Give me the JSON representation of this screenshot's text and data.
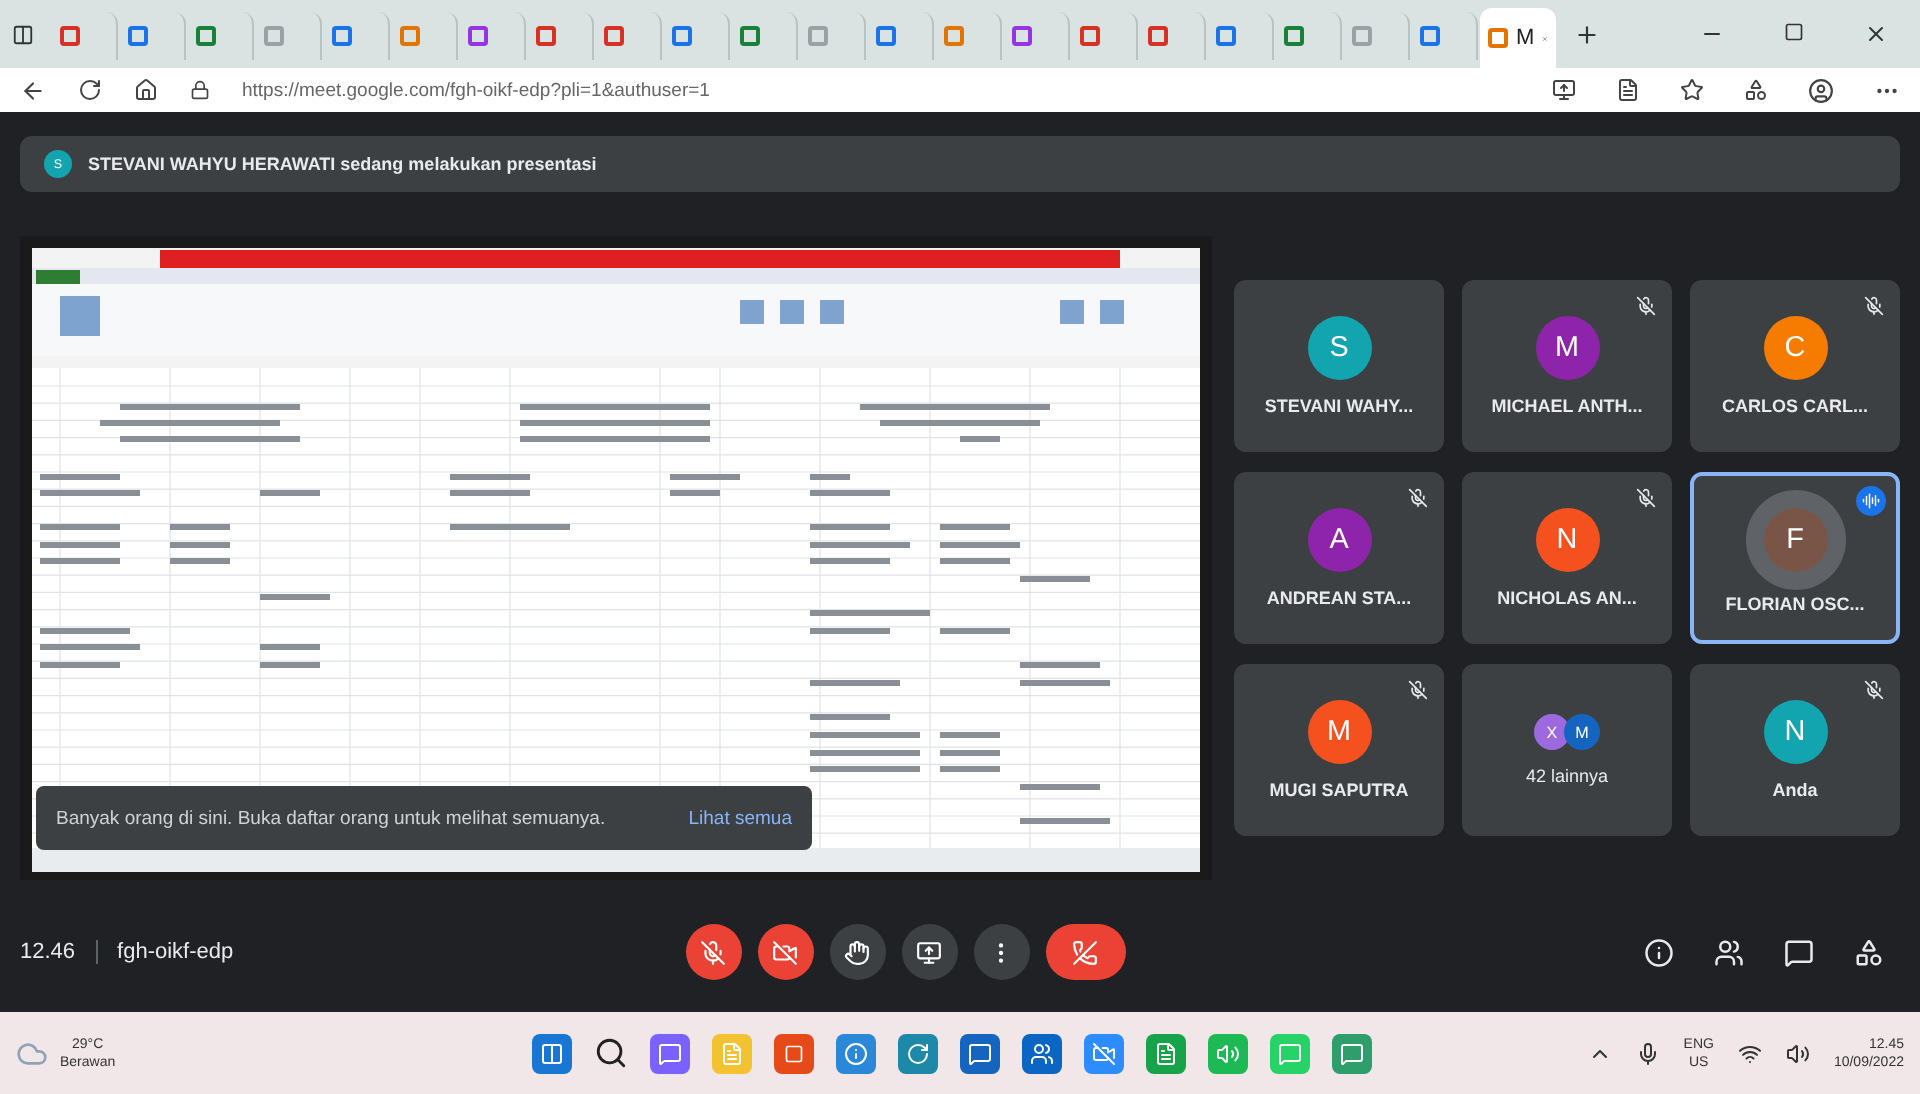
{
  "browser": {
    "tabs": [
      {
        "selected": false
      },
      {
        "selected": false
      },
      {
        "selected": false
      },
      {
        "selected": false
      },
      {
        "selected": false
      },
      {
        "selected": false
      },
      {
        "selected": false
      },
      {
        "selected": false
      },
      {
        "selected": false
      },
      {
        "selected": false
      },
      {
        "selected": false
      },
      {
        "selected": false
      },
      {
        "selected": false
      },
      {
        "selected": false
      },
      {
        "selected": false
      },
      {
        "selected": false
      },
      {
        "selected": false
      },
      {
        "selected": false
      },
      {
        "selected": false
      },
      {
        "selected": false
      },
      {
        "selected": false
      },
      {
        "title": "M",
        "selected": true
      }
    ],
    "url": "https://meet.google.com/fgh-oikf-edp?pli=1&authuser=1"
  },
  "banner": {
    "initial": "S",
    "text": "STEVANI WAHYU HERAWATI sedang melakukan presentasi"
  },
  "presentation": {
    "kind": "picture",
    "toast": {
      "text": "Banyak orang di sini. Buka daftar orang untuk melihat semuanya.",
      "link": "Lihat semua"
    }
  },
  "participants": [
    {
      "kind": "person",
      "initial": "S",
      "name": "STEVANI WAHY...",
      "color": "#12a4af",
      "muted": false,
      "speaking": false
    },
    {
      "kind": "person",
      "initial": "M",
      "name": "MICHAEL ANTH...",
      "color": "#8e24aa",
      "muted": true,
      "speaking": false
    },
    {
      "kind": "person",
      "initial": "C",
      "name": "CARLOS CARL...",
      "color": "#f57c00",
      "muted": true,
      "speaking": false
    },
    {
      "kind": "person",
      "initial": "A",
      "name": "ANDREAN STA...",
      "color": "#8e24aa",
      "muted": true,
      "speaking": false
    },
    {
      "kind": "person",
      "initial": "N",
      "name": "NICHOLAS AN...",
      "color": "#f4511e",
      "muted": true,
      "speaking": false
    },
    {
      "kind": "person",
      "initial": "F",
      "name": "FLORIAN OSC...",
      "color": "#795548",
      "muted": false,
      "speaking": true
    },
    {
      "kind": "person",
      "initial": "M",
      "name": "MUGI SAPUTRA",
      "color": "#f4511e",
      "muted": true,
      "speaking": false
    },
    {
      "kind": "more",
      "avatars": [
        {
          "initial": "X",
          "color": "#9c6ade"
        },
        {
          "initial": "M",
          "color": "#1565c0"
        }
      ],
      "name": "42 lainnya"
    },
    {
      "kind": "person",
      "initial": "N",
      "name": "Anda",
      "color": "#12a4af",
      "muted": true,
      "speaking": false
    }
  ],
  "meeting": {
    "time": "12.46",
    "code": "fgh-oikf-edp"
  },
  "taskbar": {
    "temperature": "29°C",
    "weather": "Berawan",
    "language": "ENG",
    "region": "US",
    "time": "12.45",
    "date": "10/09/2022"
  }
}
